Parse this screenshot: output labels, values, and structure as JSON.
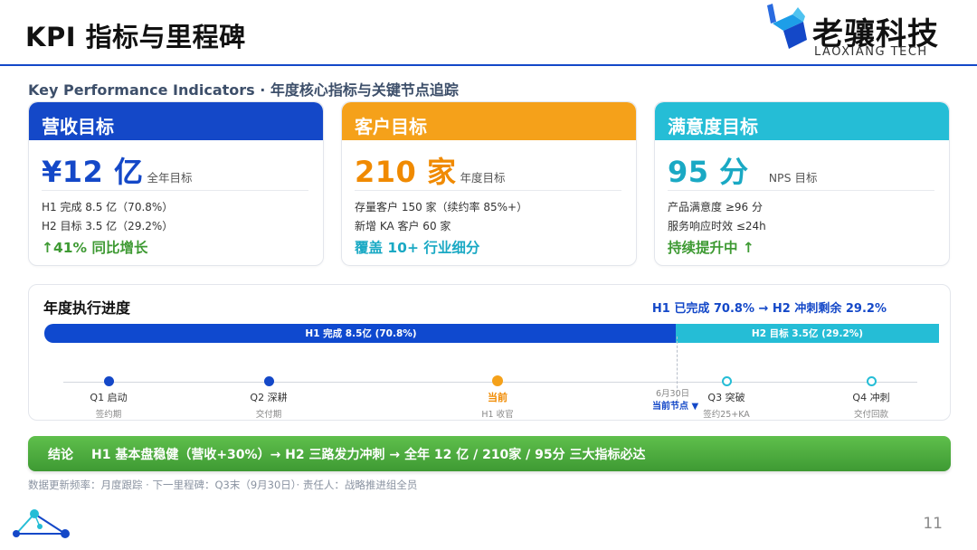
{
  "slide": {
    "title": "KPI 指标与里程碑",
    "subtitle": "Key Performance Indicators · 年度核心指标与关键节点追踪",
    "page_number": "11"
  },
  "logo": {
    "name_cn": "老骧科技",
    "name_en": "LAOXIANG TECH"
  },
  "colors": {
    "accent_blue": "#1448c8",
    "orange": "#f5a11a",
    "cyan": "#25bdd6",
    "green": "#3e9a33"
  },
  "kpi_cards": [
    {
      "header": "营收目标",
      "value": "¥12 亿",
      "value_note": "全年目标",
      "line1": "H1 完成 8.5 亿（70.8%）",
      "line2": "H2 目标 3.5 亿（29.2%）",
      "footer": "↑41% 同比增长"
    },
    {
      "header": "客户目标",
      "value": "210 家",
      "value_note": "年度目标",
      "line1": "存量客户 150 家（续约率 85%+）",
      "line2": "新增 KA 客户 60 家",
      "footer": "覆盖 10+ 行业细分"
    },
    {
      "header": "满意度目标",
      "value": "95 分",
      "value_note": "NPS 目标",
      "line1": "产品满意度 ≥96 分",
      "line2": "服务响应时效 ≤24h",
      "footer": "持续提升中 ↑"
    }
  ],
  "progress": {
    "title": "年度执行进度",
    "summary": "H1 已完成 70.8% → H2 冲刺剩余 29.2%",
    "h1_label": "H1 完成 8.5亿 (70.8%)",
    "h1_fraction": 0.708,
    "h2_label": "H2 目标 3.5亿 (29.2%)",
    "h2_fraction": 0.292,
    "marker_date": "6月30日",
    "marker_label": "当前节点 ▼",
    "milestones": [
      {
        "label": "Q1 启动",
        "sub": "签约期",
        "state": "done"
      },
      {
        "label": "Q2 深耕",
        "sub": "交付期",
        "state": "done"
      },
      {
        "label": "当前",
        "sub": "H1 收官",
        "state": "current"
      },
      {
        "label": "Q3 突破",
        "sub": "签约25+KA",
        "state": "upcoming"
      },
      {
        "label": "Q4 冲刺",
        "sub": "交付回款",
        "state": "upcoming"
      }
    ]
  },
  "conclusion": {
    "label": "结论",
    "text": "H1 基本盘稳健（营收+30%）→ H2 三路发力冲刺 → 全年 12 亿 / 210家 / 95分 三大指标必达"
  },
  "footnote": "数据更新频率：月度跟踪 · 下一里程碑：Q3末（9月30日）· 责任人：战略推进组全员"
}
